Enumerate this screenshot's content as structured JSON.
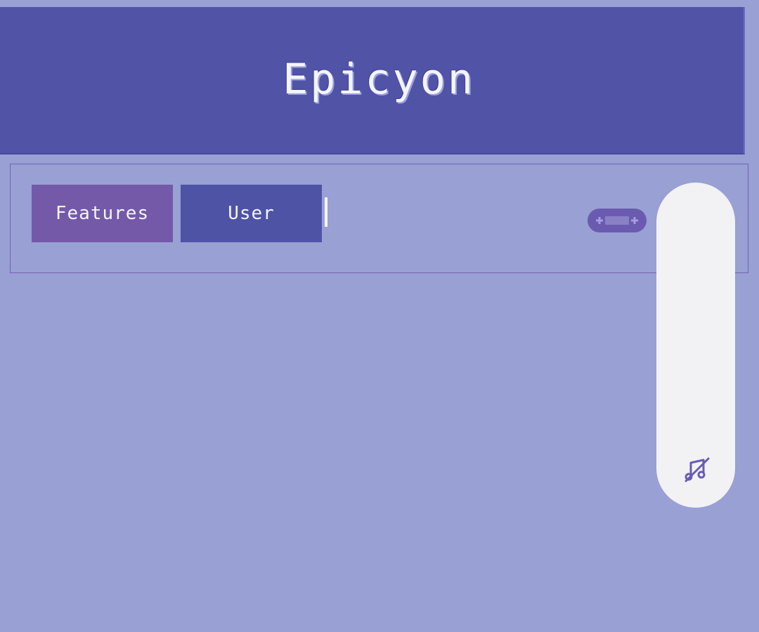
{
  "header": {
    "title": "Epicyon"
  },
  "toolbar": {
    "tabs": [
      {
        "label": "Features",
        "color": "#7459a8"
      },
      {
        "label": "User",
        "color": "#4f53a6"
      }
    ]
  },
  "icons": {
    "gamepad": "gamepad-icon",
    "music_off": "music-off-icon"
  },
  "colors": {
    "background": "#98a0d4",
    "header_bg": "#5153a6",
    "panel_bg": "#f2f2f4",
    "icon": "#6a5bb0"
  }
}
